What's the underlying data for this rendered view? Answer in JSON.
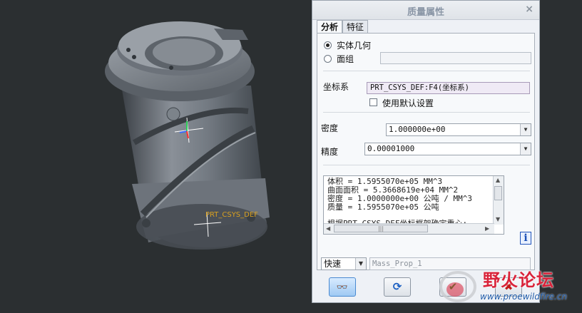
{
  "viewport": {
    "model_label": "PRT_CSYS_DEF"
  },
  "dialog": {
    "title": "质量属性",
    "close_glyph": "×",
    "tabs": [
      {
        "label": "分析"
      },
      {
        "label": "特征"
      }
    ],
    "geometry": {
      "solid_label": "实体几何",
      "quilt_label": "面组"
    },
    "csys": {
      "label": "坐标系",
      "value": "PRT_CSYS_DEF:F4(坐标系)",
      "use_default_label": "使用默认设置"
    },
    "density": {
      "label": "密度",
      "value": "1.000000e+00"
    },
    "accuracy": {
      "label": "精度",
      "value": "0.00001000"
    },
    "results": {
      "lines": [
        "体积 =  1.5955070e+05  MM^3",
        "曲面面积 =  5.3668619e+04  MM^2",
        "密度 =  1.0000000e+00 公吨 / MM^3",
        "质量 =  1.5955070e+05 公吨",
        "根据PRT_CSYS_DEF坐标框架确定重心:"
      ],
      "hscroll_grip": "|||"
    },
    "info_glyph": "i",
    "mode": {
      "value": "快速"
    },
    "name_field": {
      "value": "Mass_Prop_1"
    },
    "buttons": [
      {
        "name": "preview",
        "icon": "glasses-icon",
        "glyph": "👓"
      },
      {
        "name": "repeat",
        "icon": "repeat-icon",
        "glyph": "⟳"
      },
      {
        "name": "ok",
        "icon": "check-icon",
        "glyph": "✔"
      },
      {
        "name": "cancel",
        "icon": "x-icon",
        "glyph": "✖"
      }
    ]
  },
  "watermark": {
    "main": "野火论坛",
    "url": "www.proewildfire.cn"
  },
  "colors": {
    "background": "#2b2f31",
    "dialog": "#eef1f6",
    "accent": "#4a8ad1",
    "ok_green": "#1e9b2a",
    "cancel_red": "#c21818"
  }
}
